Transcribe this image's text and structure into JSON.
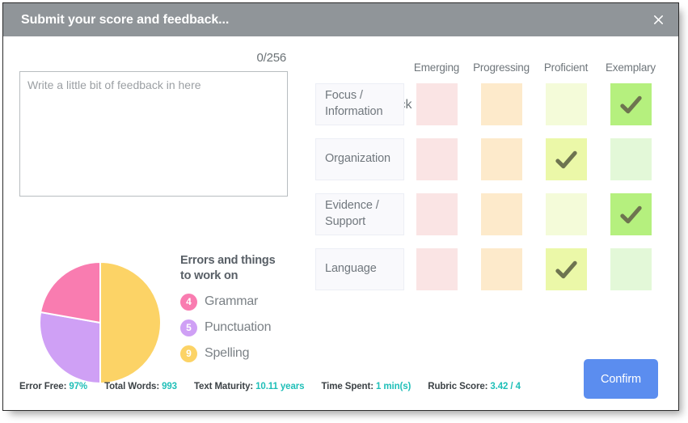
{
  "window": {
    "title": "Submit your score and feedback...",
    "close_icon": "close-icon",
    "titlebar_color": "#909599"
  },
  "feedback": {
    "counter": "0/256",
    "placeholder": "Write a little bit of feedback in here",
    "value": ""
  },
  "errors": {
    "heading": "Errors and things to work on",
    "items": [
      {
        "count": "4",
        "label": "Grammar",
        "color": "#f97cb0"
      },
      {
        "count": "5",
        "label": "Punctuation",
        "color": "#cfa0f5"
      },
      {
        "count": "9",
        "label": "Spelling",
        "color": "#fcd366"
      }
    ]
  },
  "chart_data": {
    "type": "pie",
    "title": "Errors and things to work on",
    "categories": [
      "Grammar",
      "Punctuation",
      "Spelling"
    ],
    "values": [
      4,
      5,
      9
    ],
    "total": 18,
    "colors": [
      "#f97cb0",
      "#cfa0f5",
      "#fcd366"
    ],
    "legend": "right",
    "start_angle_deg": 0,
    "slice_angles_deg": [
      80,
      100,
      180
    ],
    "labels_shown": false
  },
  "rubric": {
    "heading": "Rubric Feedback",
    "columns": [
      "Emerging",
      "Progressing",
      "Proficient",
      "Exemplary"
    ],
    "column_colors": {
      "unselected": [
        "#fae4e4",
        "#fdeacb",
        "#f4fbd9",
        "#e3f8d8"
      ],
      "selected": [
        "#f6c9c9",
        "#fbd79f",
        "#ebf8a8",
        "#b5f07e"
      ]
    },
    "check_color": "#6e7450",
    "rows": [
      {
        "label": "Focus / Information",
        "selected": 3
      },
      {
        "label": "Organization",
        "selected": 2
      },
      {
        "label": "Evidence / Support",
        "selected": 3
      },
      {
        "label": "Language",
        "selected": 2
      }
    ]
  },
  "footer": {
    "stats": [
      {
        "label": "Error Free:",
        "value": "97%"
      },
      {
        "label": "Total Words:",
        "value": "993"
      },
      {
        "label": "Text Maturity:",
        "value": "10.11 years"
      },
      {
        "label": "Time Spent:",
        "value": "1 min(s)"
      },
      {
        "label": "Rubric Score:",
        "value": "3.42 / 4"
      }
    ],
    "confirm_label": "Confirm",
    "accent_color": "#1fbfb8",
    "confirm_color": "#5b8def"
  }
}
